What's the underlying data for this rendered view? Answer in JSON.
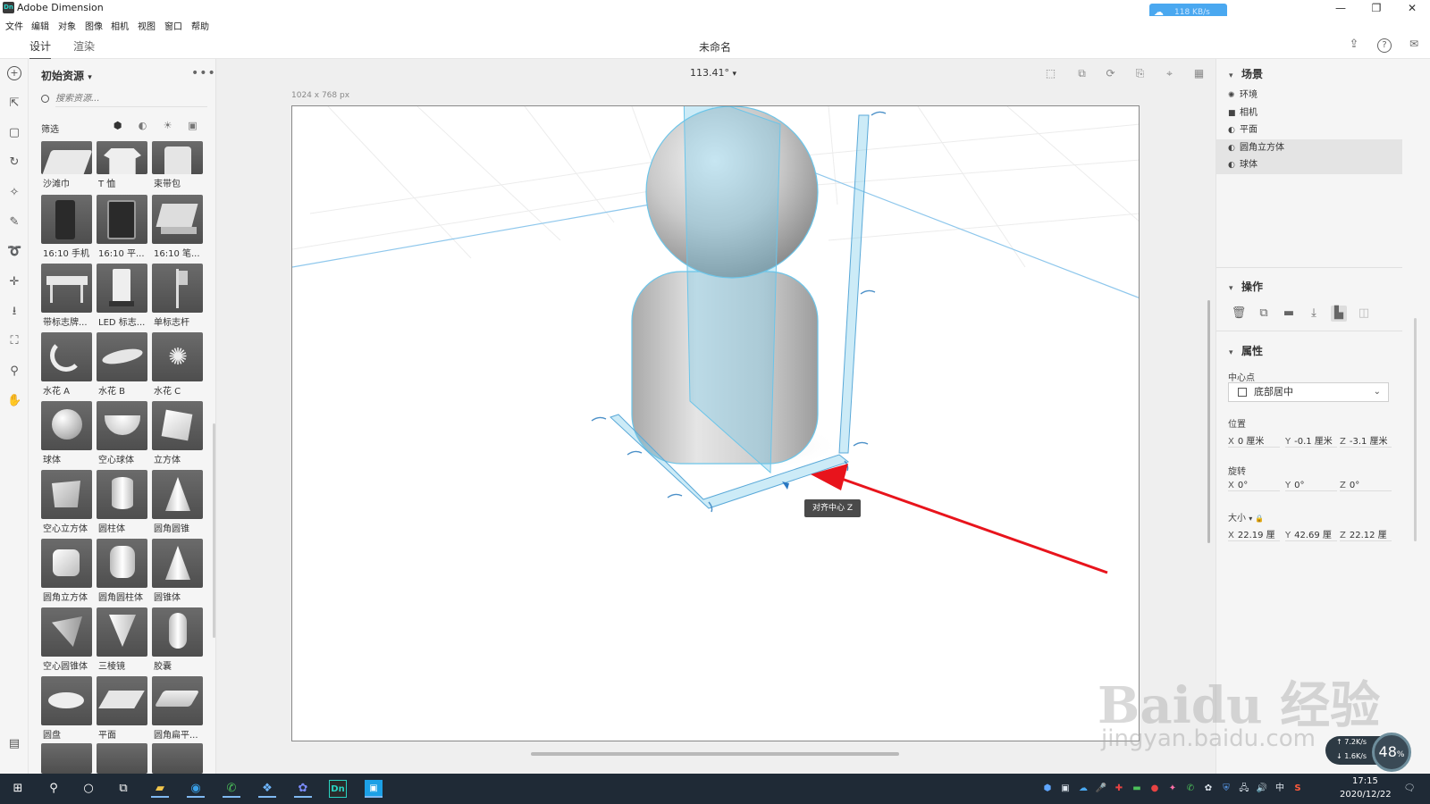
{
  "app": {
    "title": "Adobe Dimension",
    "logo_text": "Dn"
  },
  "net_speed": "118 KB/s",
  "window_controls": {
    "minimize": "—",
    "restore": "❐",
    "close": "✕"
  },
  "menu": [
    "文件",
    "编辑",
    "对象",
    "图像",
    "相机",
    "视图",
    "窗口",
    "帮助"
  ],
  "tabs": {
    "design": "设计",
    "render": "渲染"
  },
  "document_title": "未命名",
  "assets": {
    "title": "初始资源",
    "more": "•••",
    "search_placeholder": "搜索资源...",
    "filter_label": "筛选",
    "items": [
      {
        "label": "沙滩巾",
        "shape": "towel"
      },
      {
        "label": "T 恤",
        "shape": "tshirt"
      },
      {
        "label": "束带包",
        "shape": "bag"
      },
      {
        "label": "16:10 手机",
        "shape": "phone"
      },
      {
        "label": "16:10 平...",
        "shape": "tablet"
      },
      {
        "label": "16:10 笔...",
        "shape": "laptop"
      },
      {
        "label": "带标志牌...",
        "shape": "bench"
      },
      {
        "label": "LED 标志...",
        "shape": "ledsign"
      },
      {
        "label": "单标志杆",
        "shape": "flag"
      },
      {
        "label": "水花 A",
        "shape": "splashA"
      },
      {
        "label": "水花 B",
        "shape": "splashB"
      },
      {
        "label": "水花 C",
        "shape": "splashC"
      },
      {
        "label": "球体",
        "shape": "sphere"
      },
      {
        "label": "空心球体",
        "shape": "bowl"
      },
      {
        "label": "立方体",
        "shape": "cube"
      },
      {
        "label": "空心立方体",
        "shape": "hollowcube"
      },
      {
        "label": "圆柱体",
        "shape": "cylinder"
      },
      {
        "label": "圆角圆锥",
        "shape": "cone"
      },
      {
        "label": "圆角立方体",
        "shape": "roundcube"
      },
      {
        "label": "圆角圆柱体",
        "shape": "roundcyl"
      },
      {
        "label": "圆锥体",
        "shape": "cone"
      },
      {
        "label": "空心圆锥体",
        "shape": "hollowcone"
      },
      {
        "label": "三棱镜",
        "shape": "prism"
      },
      {
        "label": "胶囊",
        "shape": "capsule"
      },
      {
        "label": "圆盘",
        "shape": "disc"
      },
      {
        "label": "平面",
        "shape": "plane"
      },
      {
        "label": "圆角扁平...",
        "shape": "flatbox"
      }
    ]
  },
  "viewport": {
    "zoom": "113.41°",
    "canvas_size": "1024 x 768 px",
    "tooltip": "对齐中心 Z"
  },
  "scene": {
    "title": "场景",
    "items": [
      {
        "label": "环境",
        "icon": "environment-icon",
        "selected": false
      },
      {
        "label": "相机",
        "icon": "camera-icon",
        "selected": false
      },
      {
        "label": "平面",
        "icon": "material-icon",
        "selected": false
      },
      {
        "label": "圆角立方体",
        "icon": "material-icon",
        "selected": true
      },
      {
        "label": "球体",
        "icon": "material-icon",
        "selected": true
      }
    ]
  },
  "actions": {
    "title": "操作"
  },
  "properties": {
    "title": "属性",
    "pivot_label": "中心点",
    "pivot_value": "底部居中",
    "position_label": "位置",
    "position": {
      "x": "0 厘米",
      "y": "-0.1 厘米",
      "z": "-3.1 厘米"
    },
    "rotation_label": "旋转",
    "rotation": {
      "x": "0°",
      "y": "0°",
      "z": "0°"
    },
    "size_label": "大小",
    "size": {
      "x": "22.19 厘",
      "y": "42.69 厘",
      "z": "22.12 厘"
    }
  },
  "taskbar": {
    "time": "17:15",
    "date": "2020/12/22",
    "ime": "中"
  },
  "speed_widget": {
    "up": "7.2K/s",
    "down": "1.6K/s",
    "percent": "48",
    "percent_unit": "%"
  },
  "watermark": {
    "line1": "Baidu 经验",
    "line2": "jingyan.baidu.com"
  },
  "colors": {
    "accent": "#4aa8f0",
    "selection": "#6cc5e9",
    "arrow": "#e8141c"
  }
}
